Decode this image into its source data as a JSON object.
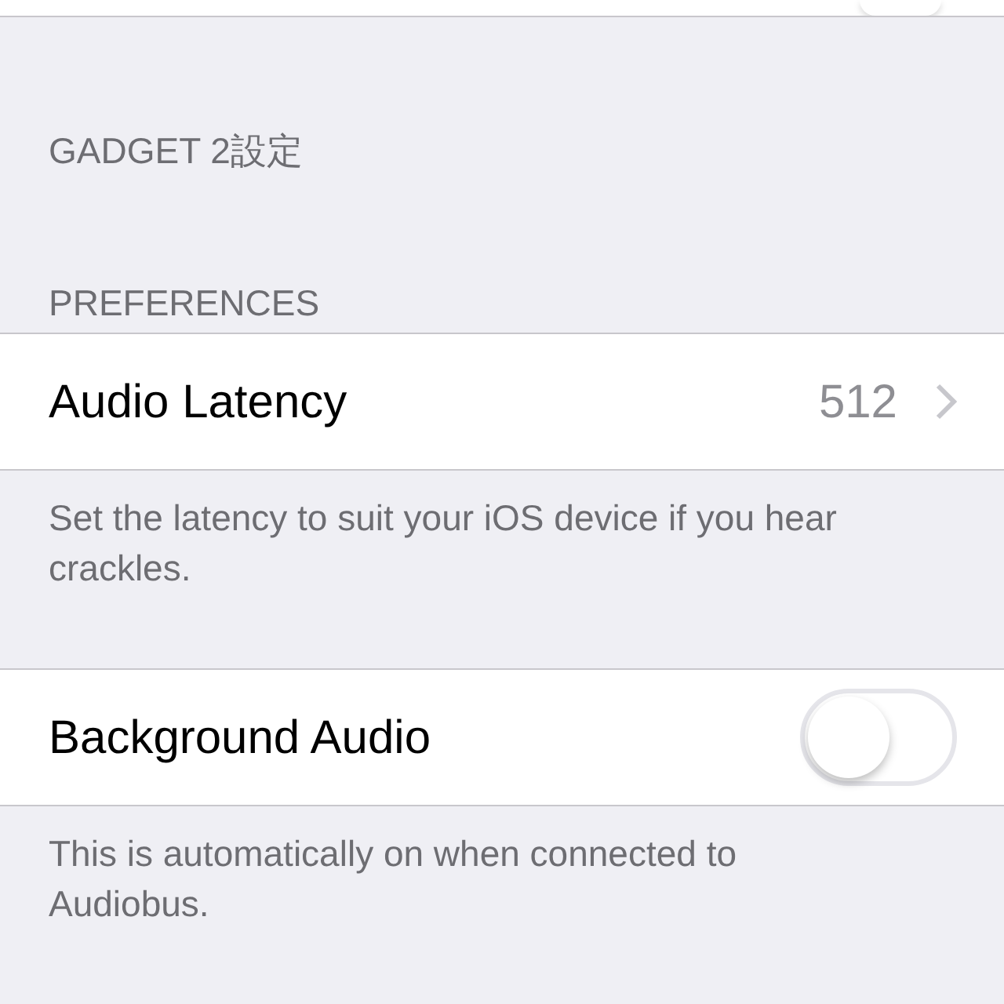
{
  "group_header": "GADGET 2設定",
  "section": {
    "header": "PREFERENCES"
  },
  "rows": [
    {
      "kind": "value",
      "label": "Audio Latency",
      "value": "512",
      "footer": "Set the latency to suit your iOS device if you hear crackles."
    },
    {
      "kind": "switch",
      "label": "Background Audio",
      "on": false,
      "footer": "This is automatically on when connected to Audiobus."
    }
  ]
}
